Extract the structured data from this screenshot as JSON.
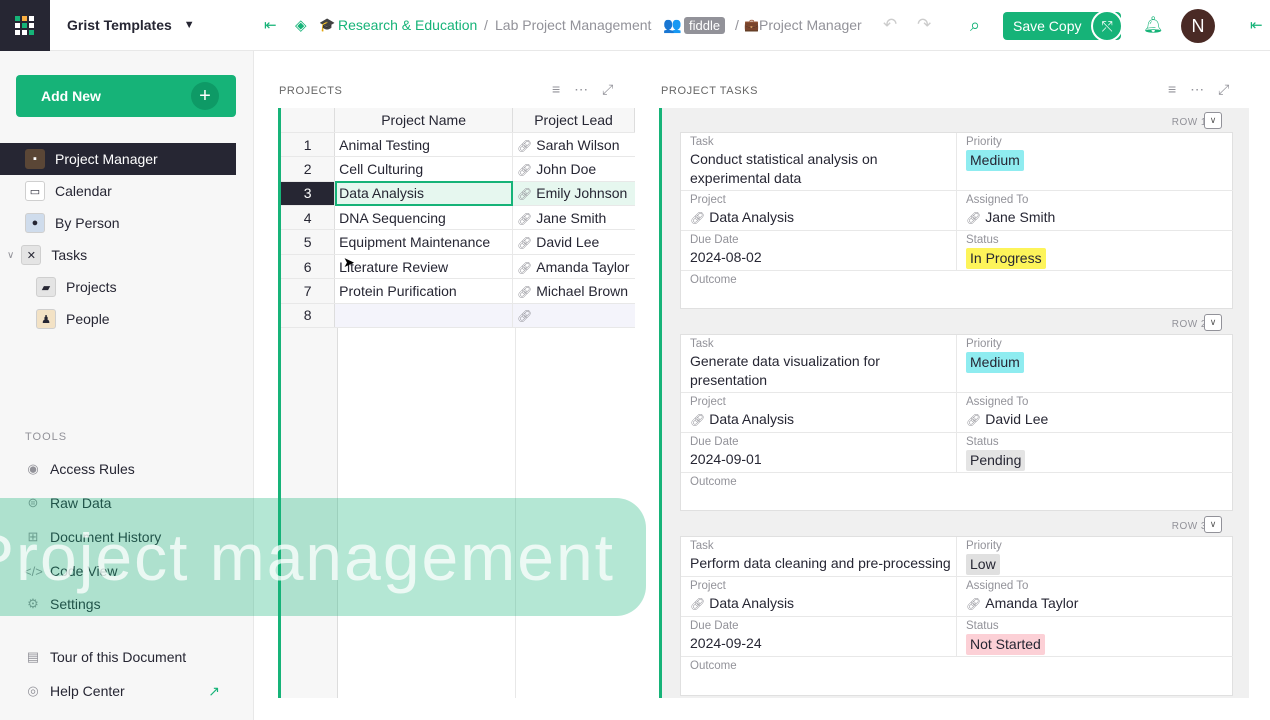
{
  "org": {
    "name": "Grist Templates"
  },
  "sidebar": {
    "add_new": "Add New",
    "pages": [
      {
        "label": "Project Manager",
        "icon": "briefcase-icon",
        "active": true
      },
      {
        "label": "Calendar",
        "icon": "calendar-icon"
      },
      {
        "label": "By Person",
        "icon": "person-icon"
      },
      {
        "label": "Tasks",
        "icon": "tools-icon"
      },
      {
        "label": "Projects",
        "icon": "folder-icon"
      },
      {
        "label": "People",
        "icon": "people-icon"
      }
    ],
    "tools_header": "TOOLS",
    "tools": [
      "Access Rules",
      "Raw Data",
      "Document History",
      "Code View",
      "Settings"
    ],
    "footer": [
      "Tour of this Document",
      "Help Center"
    ]
  },
  "topbar": {
    "workspace": "Research & Education",
    "doc": "Lab Project Management",
    "badge": "fiddle",
    "page": "Project Manager",
    "save_copy": "Save Copy",
    "avatar": "N"
  },
  "projects": {
    "title": "PROJECTS",
    "columns": [
      "Project Name",
      "Project Lead"
    ],
    "rows": [
      {
        "n": "1",
        "name": "Animal Testing",
        "lead": "Sarah Wilson"
      },
      {
        "n": "2",
        "name": "Cell Culturing",
        "lead": "John Doe"
      },
      {
        "n": "3",
        "name": "Data Analysis",
        "lead": "Emily Johnson"
      },
      {
        "n": "4",
        "name": "DNA Sequencing",
        "lead": "Jane Smith"
      },
      {
        "n": "5",
        "name": "Equipment Maintenance",
        "lead": "David Lee"
      },
      {
        "n": "6",
        "name": "Literature Review",
        "lead": "Amanda Taylor"
      },
      {
        "n": "7",
        "name": "Protein Purification",
        "lead": "Michael Brown"
      },
      {
        "n": "8",
        "name": "",
        "lead": ""
      }
    ]
  },
  "tasks": {
    "title": "PROJECT TASKS",
    "labels": {
      "task": "Task",
      "priority": "Priority",
      "project": "Project",
      "assigned": "Assigned To",
      "due": "Due Date",
      "status": "Status",
      "outcome": "Outcome"
    },
    "cards": [
      {
        "row": "ROW 1",
        "task": "Conduct statistical analysis on experimental data",
        "priority": "Medium",
        "project": "Data Analysis",
        "assigned": "Jane Smith",
        "due": "2024-08-02",
        "status": "In Progress"
      },
      {
        "row": "ROW 2",
        "task": "Generate data visualization for presentation",
        "priority": "Medium",
        "project": "Data Analysis",
        "assigned": "David Lee",
        "due": "2024-09-01",
        "status": "Pending"
      },
      {
        "row": "ROW 3",
        "task": "Perform data cleaning and pre-processing",
        "priority": "Low",
        "project": "Data Analysis",
        "assigned": "Amanda Taylor",
        "due": "2024-09-24",
        "status": "Not Started"
      }
    ]
  },
  "overlay_text": "Project management",
  "colors": {
    "accent": "#16b378",
    "medium": "#8fecf0",
    "low": "#e0e0e0",
    "in_progress": "#fdf45a",
    "pending": "#e4e4e4",
    "not_started": "#fcd0d6"
  }
}
